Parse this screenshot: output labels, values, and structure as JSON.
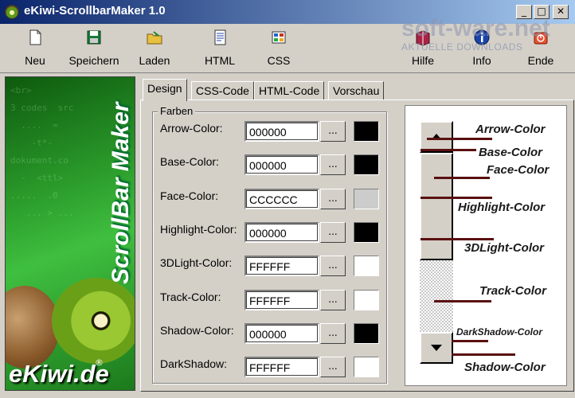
{
  "window": {
    "title": "eKiwi-ScrollbarMaker 1.0",
    "controls": {
      "minimize": "_",
      "maximize": "□",
      "close": "✕"
    }
  },
  "toolbar": {
    "new_label": "Neu",
    "save_label": "Speichern",
    "load_label": "Laden",
    "html_label": "HTML",
    "css_label": "CSS",
    "help_label": "Hilfe",
    "info_label": "Info",
    "exit_label": "Ende"
  },
  "watermark": {
    "brand": "soft-ware.net",
    "tagline": "AKTUELLE DOWNLOADS"
  },
  "banner": {
    "title": "ScrollBar Maker",
    "brand": "eKiwi.de",
    "registered": "®"
  },
  "tabs": [
    {
      "label": "Design",
      "active": true
    },
    {
      "label": "CSS-Code",
      "active": false
    },
    {
      "label": "HTML-Code",
      "active": false
    },
    {
      "label": "Vorschau",
      "active": false
    }
  ],
  "colors_group": {
    "title": "Farben",
    "button_label": "...",
    "rows": [
      {
        "label": "Arrow-Color:",
        "value": "000000",
        "swatch": "#000000"
      },
      {
        "label": "Base-Color:",
        "value": "000000",
        "swatch": "#000000"
      },
      {
        "label": "Face-Color:",
        "value": "CCCCCC",
        "swatch": "#cccccc"
      },
      {
        "label": "Highlight-Color:",
        "value": "000000",
        "swatch": "#000000"
      },
      {
        "label": "3DLight-Color:",
        "value": "FFFFFF",
        "swatch": "#ffffff"
      },
      {
        "label": "Track-Color:",
        "value": "FFFFFF",
        "swatch": "#ffffff"
      },
      {
        "label": "Shadow-Color:",
        "value": "000000",
        "swatch": "#000000"
      },
      {
        "label": "DarkShadow:",
        "value": "FFFFFF",
        "swatch": "#ffffff"
      }
    ]
  },
  "preview": {
    "labels": {
      "arrow": "Arrow-Color",
      "base": "Base-Color",
      "face": "Face-Color",
      "highlight": "Highlight-Color",
      "light3d": "3DLight-Color",
      "track": "Track-Color",
      "darkshadow": "DarkShadow-Color",
      "shadow": "Shadow-Color"
    }
  }
}
